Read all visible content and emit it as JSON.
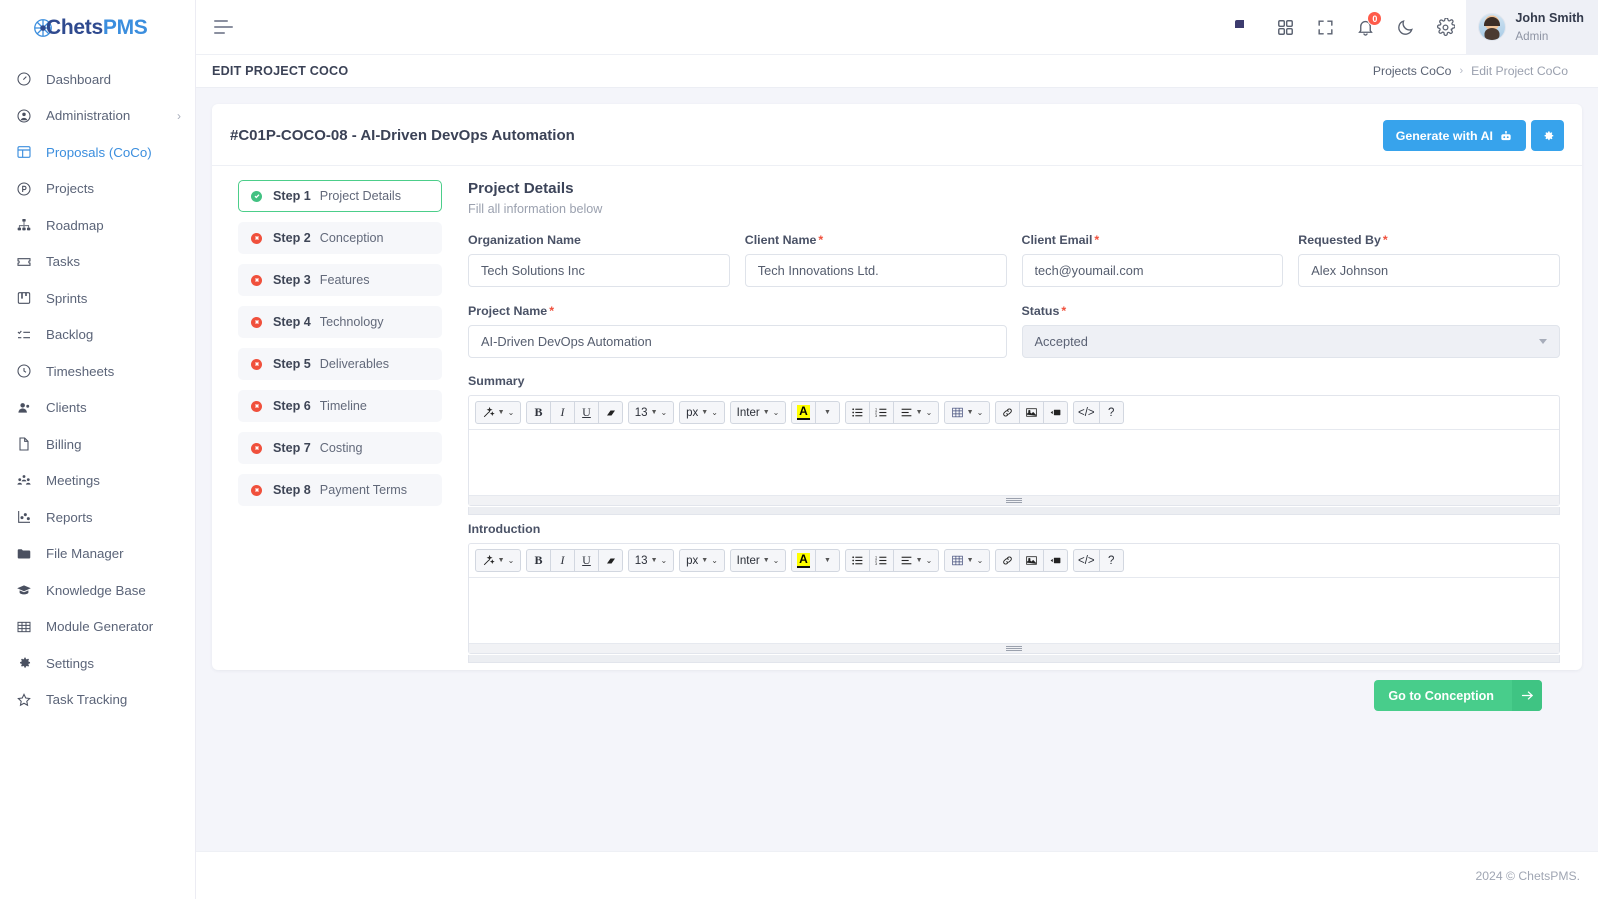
{
  "brand": {
    "name_dark": "hets",
    "name_light": "PMS",
    "prefix": "C",
    "accent": "#3b8ede"
  },
  "sidebar": {
    "items": [
      {
        "label": "Dashboard",
        "icon": "speedometer-icon",
        "active": false,
        "chevron": false
      },
      {
        "label": "Administration",
        "icon": "user-circle-icon",
        "active": false,
        "chevron": true
      },
      {
        "label": "Proposals (CoCo)",
        "icon": "layout-icon",
        "active": true,
        "chevron": false
      },
      {
        "label": "Projects",
        "icon": "p-circle-icon",
        "active": false,
        "chevron": false
      },
      {
        "label": "Roadmap",
        "icon": "sitemap-icon",
        "active": false,
        "chevron": false
      },
      {
        "label": "Tasks",
        "icon": "ticket-icon",
        "active": false,
        "chevron": false
      },
      {
        "label": "Sprints",
        "icon": "board-icon",
        "active": false,
        "chevron": false
      },
      {
        "label": "Backlog",
        "icon": "list-check-icon",
        "active": false,
        "chevron": false
      },
      {
        "label": "Timesheets",
        "icon": "clock-icon",
        "active": false,
        "chevron": false
      },
      {
        "label": "Clients",
        "icon": "users-icon",
        "active": false,
        "chevron": false
      },
      {
        "label": "Billing",
        "icon": "file-icon",
        "active": false,
        "chevron": false
      },
      {
        "label": "Meetings",
        "icon": "people-group-icon",
        "active": false,
        "chevron": false
      },
      {
        "label": "Reports",
        "icon": "chart-icon",
        "active": false,
        "chevron": false
      },
      {
        "label": "File Manager",
        "icon": "folder-icon",
        "active": false,
        "chevron": false
      },
      {
        "label": "Knowledge Base",
        "icon": "graduation-cap-icon",
        "active": false,
        "chevron": false
      },
      {
        "label": "Module Generator",
        "icon": "grid-table-icon",
        "active": false,
        "chevron": false
      },
      {
        "label": "Settings",
        "icon": "gear-icon",
        "active": false,
        "chevron": false
      },
      {
        "label": "Task Tracking",
        "icon": "star-icon",
        "active": false,
        "chevron": false
      }
    ]
  },
  "topbar": {
    "menu_toggle": "hamburger-icon",
    "language_flag": "us-flag-icon",
    "apps_icon": "grid-apps-icon",
    "fullscreen_icon": "fullscreen-icon",
    "notifications_icon": "bell-icon",
    "notifications_count": "0",
    "theme_icon": "moon-icon",
    "settings_icon": "gear-icon",
    "user": {
      "name": "John Smith",
      "role": "Admin"
    }
  },
  "header": {
    "page_title": "EDIT PROJECT COCO",
    "breadcrumb": {
      "parent": "Projects CoCo",
      "separator": "›",
      "current": "Edit Project CoCo"
    }
  },
  "card": {
    "title": "#C01P-COCO-08 - AI-Driven DevOps Automation",
    "actions": {
      "generate_label": "Generate with AI",
      "generate_icon": "robot-icon",
      "settings_icon": "gear-icon"
    }
  },
  "steps": [
    {
      "num": "Step 1",
      "name": "Project Details",
      "state": "done"
    },
    {
      "num": "Step 2",
      "name": "Conception",
      "state": "incomplete"
    },
    {
      "num": "Step 3",
      "name": "Features",
      "state": "incomplete"
    },
    {
      "num": "Step 4",
      "name": "Technology",
      "state": "incomplete"
    },
    {
      "num": "Step 5",
      "name": "Deliverables",
      "state": "incomplete"
    },
    {
      "num": "Step 6",
      "name": "Timeline",
      "state": "incomplete"
    },
    {
      "num": "Step 7",
      "name": "Costing",
      "state": "incomplete"
    },
    {
      "num": "Step 8",
      "name": "Payment Terms",
      "state": "incomplete"
    }
  ],
  "form": {
    "title": "Project Details",
    "subtitle": "Fill all information below",
    "fields": {
      "organization_name": {
        "label": "Organization Name",
        "value": "Tech Solutions Inc",
        "required": false
      },
      "client_name": {
        "label": "Client Name",
        "value": "Tech Innovations Ltd.",
        "required": true
      },
      "client_email": {
        "label": "Client Email",
        "value": "tech@youmail.com",
        "required": true
      },
      "requested_by": {
        "label": "Requested By",
        "value": "Alex Johnson",
        "required": true
      },
      "project_name": {
        "label": "Project Name",
        "value": "AI-Driven DevOps Automation",
        "required": true
      },
      "status": {
        "label": "Status",
        "value": "Accepted",
        "required": true
      }
    },
    "summary_label": "Summary",
    "summary_value": "",
    "introduction_label": "Introduction",
    "introduction_value": ""
  },
  "editor_toolbar": {
    "magic_label": "magic-wand-icon",
    "bold_label": "B",
    "italic_label": "I",
    "underline_label": "U",
    "eraser_label": "eraser-icon",
    "font_size": "13",
    "font_unit": "px",
    "font_family": "Inter",
    "font_color_label": "A",
    "unordered_list": "bullet-list-icon",
    "ordered_list": "numbered-list-icon",
    "align": "align-icon",
    "table": "table-icon",
    "link": "link-icon",
    "image": "image-icon",
    "video": "video-icon",
    "code": "</>",
    "help": "?"
  },
  "footer_nav": {
    "next_label": "Go to Conception",
    "next_icon": "arrow-right-icon"
  },
  "footer": {
    "copyright": "2024 © ChetsPMS."
  }
}
